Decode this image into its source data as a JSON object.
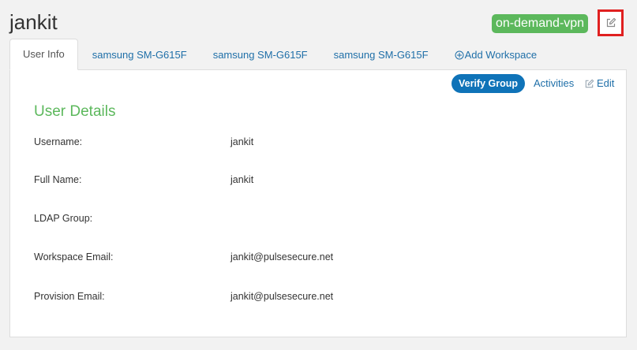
{
  "header": {
    "title": "jankit",
    "badge": "on-demand-vpn",
    "edit_icon": "pencil-square-icon"
  },
  "tabs": [
    {
      "label": "User Info",
      "active": true
    },
    {
      "label": "samsung SM-G615F",
      "active": false
    },
    {
      "label": "samsung SM-G615F",
      "active": false
    },
    {
      "label": "samsung SM-G615F",
      "active": false
    },
    {
      "label": "Add Workspace",
      "icon": "plus-circle-icon",
      "active": false
    }
  ],
  "actions": {
    "verify_label": "Verify Group",
    "activities_label": "Activities",
    "edit_label": "Edit"
  },
  "details": {
    "title": "User Details",
    "rows": [
      {
        "label": "Username:",
        "value": "jankit"
      },
      {
        "label": "Full Name:",
        "value": "jankit"
      },
      {
        "label": "LDAP Group:",
        "value": ""
      },
      {
        "label": "Workspace Email:",
        "value": "jankit@pulsesecure.net"
      },
      {
        "label": "Provision Email:",
        "value": "jankit@pulsesecure.net"
      }
    ]
  },
  "colors": {
    "accent_blue": "#0f73b8",
    "link_blue": "#1f6fa8",
    "green": "#5cb85c",
    "highlight_red": "#e02020"
  }
}
